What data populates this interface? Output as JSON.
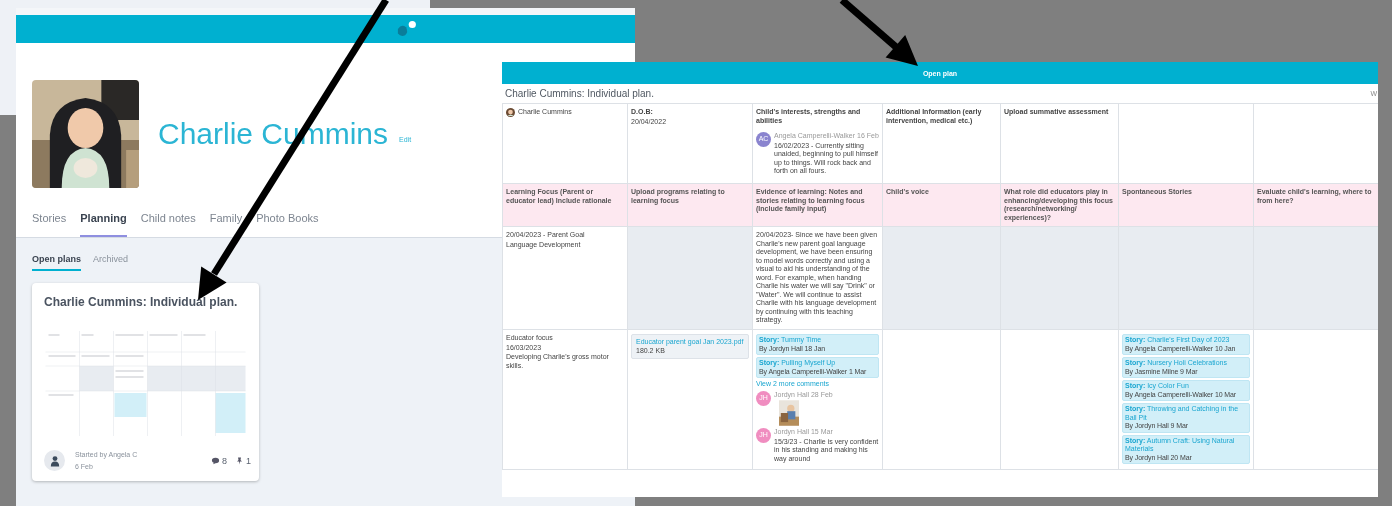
{
  "profile": {
    "name": "Charlie Cummins",
    "edit": "Edit",
    "tabs": [
      {
        "label": "Stories",
        "selected": false
      },
      {
        "label": "Planning",
        "selected": true
      },
      {
        "label": "Child notes",
        "selected": false
      },
      {
        "label": "Family",
        "selected": false
      },
      {
        "label": "Photo Books",
        "selected": false
      }
    ],
    "subtabs": [
      {
        "label": "Open plans",
        "selected": true
      },
      {
        "label": "Archived",
        "selected": false
      }
    ],
    "card": {
      "title": "Charlie Cummins: Individual plan.",
      "started_by": "Started by Angela C",
      "date": "6 Feb",
      "comments": "8",
      "pins": "1"
    }
  },
  "plan": {
    "header": "Open plan",
    "title": "Charlie Cummins: Individual plan.",
    "corner": "W",
    "rows": [
      {
        "kind": "info",
        "cells": [
          {
            "shaded": false,
            "items": [
              {
                "kind": "child",
                "text": "Charlie Cummins"
              }
            ]
          },
          {
            "shaded": false,
            "items": [
              {
                "kind": "text",
                "text": "D.O.B:"
              },
              {
                "kind": "text",
                "text": "20/04/2022"
              }
            ]
          },
          {
            "shaded": false,
            "items": [
              {
                "kind": "text",
                "text": "Child's interests, strengths and abilities"
              },
              {
                "kind": "comment",
                "initials": "AC",
                "color": "#8a84cf",
                "meta": "Angela Camperelli-Walker 16 Feb",
                "text": "16/02/2023 - Currently sitting unaided, beginning to pull himself up to things. Will rock back and forth on all fours."
              }
            ]
          },
          {
            "shaded": false,
            "items": [
              {
                "kind": "text",
                "text": "Additional Information (early intervention, medical etc.)"
              }
            ]
          },
          {
            "shaded": false,
            "items": [
              {
                "kind": "text",
                "text": "Upload summative assessment"
              }
            ]
          },
          {
            "shaded": false
          },
          {
            "shaded": false
          }
        ]
      },
      {
        "kind": "header",
        "cells": [
          {
            "shaded": false,
            "items": [
              {
                "kind": "text",
                "text": "Learning Focus (Parent or educator lead) Include rationale"
              }
            ]
          },
          {
            "shaded": false,
            "items": [
              {
                "kind": "text",
                "text": "Upload programs relating to learning focus"
              }
            ]
          },
          {
            "shaded": false,
            "items": [
              {
                "kind": "text",
                "text": "Evidence of learning: Notes and stories relating to learning focus (Include family input)"
              }
            ]
          },
          {
            "shaded": false,
            "items": [
              {
                "kind": "text",
                "text": "Child's voice"
              }
            ]
          },
          {
            "shaded": false,
            "items": [
              {
                "kind": "text",
                "text": "What role did educators play in enhancing/developing this focus (research/networking/ experiences)?"
              }
            ]
          },
          {
            "shaded": false,
            "items": [
              {
                "kind": "text",
                "text": "Spontaneous Stories"
              }
            ]
          },
          {
            "shaded": false,
            "items": [
              {
                "kind": "text",
                "text": "Evaluate child's learning, where to from here?"
              }
            ]
          }
        ]
      },
      {
        "kind": "content",
        "cells": [
          {
            "shaded": false,
            "items": [
              {
                "kind": "text",
                "text": "20/04/2023 - Parent Goal"
              },
              {
                "kind": "text",
                "text": "Language Development"
              }
            ]
          },
          {
            "shaded": true
          },
          {
            "shaded": false,
            "items": [
              {
                "kind": "text",
                "text": "20/04/2023- Since we have been given Charlie's new parent goal language development, we have been ensuring to model words correctly and using a visual to aid his understanding of the word. For example, when handing Charlie his water we will say \"Drink\" or \"Water\". We will continue to assist Charlie with his language development by continuing with this teaching strategy."
              }
            ]
          },
          {
            "shaded": true
          },
          {
            "shaded": true
          },
          {
            "shaded": true
          },
          {
            "shaded": true
          }
        ]
      },
      {
        "kind": "content",
        "cells": [
          {
            "shaded": false,
            "items": [
              {
                "kind": "text",
                "text": "Educator focus"
              },
              {
                "kind": "text",
                "text": "16/03/2023"
              },
              {
                "kind": "text",
                "text": "Developing Charlie's gross motor skills."
              }
            ]
          },
          {
            "shaded": false,
            "items": [
              {
                "kind": "file",
                "name": "Educator parent goal Jan 2023.pdf",
                "size": "180.2 KB"
              }
            ]
          },
          {
            "shaded": false,
            "items": [
              {
                "kind": "story",
                "title": "**Story:** Tummy Time",
                "byline": "By Jordyn Hall 18 Jan"
              },
              {
                "kind": "story",
                "title": "**Story:** Pulling Myself Up",
                "byline": "By Angela Camperelli-Walker 1 Mar"
              },
              {
                "kind": "link",
                "text": "View 2 more comments"
              },
              {
                "kind": "comment",
                "initials": "JH",
                "color": "#f08dc0",
                "meta": "Jordyn Hall 28 Feb",
                "photo": true
              },
              {
                "kind": "comment",
                "initials": "JH",
                "color": "#f08dc0",
                "meta": "Jordyn Hall 15 Mar",
                "text": "15/3/23 - Charlie is very confident in his standing and making his way around"
              }
            ]
          },
          {
            "shaded": false
          },
          {
            "shaded": false
          },
          {
            "shaded": false,
            "items": [
              {
                "kind": "story",
                "title": "**Story:** Charlie's First Day of 2023",
                "byline": "By Angela Camperelli-Walker 10 Jan"
              },
              {
                "kind": "story",
                "title": "**Story:** Nursery Holi Celebrations",
                "byline": "By Jasmine Milne 9 Mar"
              },
              {
                "kind": "story",
                "title": "**Story:** Icy Color Fun",
                "byline": "By Angela Camperelli-Walker 10 Mar"
              },
              {
                "kind": "story",
                "title": "**Story:** Throwing and Catching in the Ball Pit",
                "byline": "By Jordyn Hall 9 Mar"
              },
              {
                "kind": "story",
                "title": "**Story:** Autumn Craft: Using Natural Materials",
                "byline": "By Jordyn Hall 20 Mar"
              }
            ]
          },
          {
            "shaded": false
          }
        ]
      }
    ]
  }
}
